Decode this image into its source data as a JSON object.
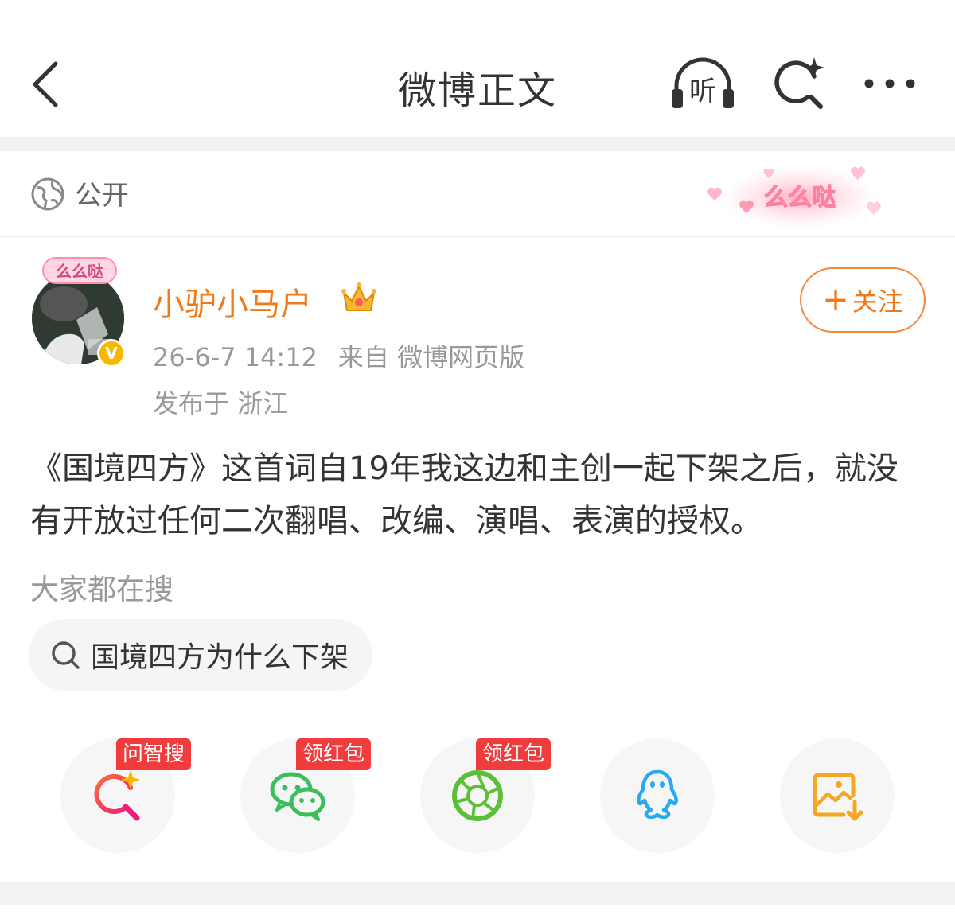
{
  "header": {
    "title": "微博正文",
    "listen_label": "听"
  },
  "visibility": {
    "label": "公开",
    "decoration_text": "么么哒"
  },
  "post": {
    "author": {
      "name": "小驴小马户",
      "avatar_frame_text": "么么哒",
      "verified_mark": "V"
    },
    "timestamp": "26-6-7 14:12",
    "source": "来自 微博网页版",
    "location": "发布于 浙江",
    "follow_button": {
      "plus": "+",
      "label": "关注"
    },
    "text": "《国境四方》这首词自19年我这边和主创一起下架之后，就没有开放过任何二次翻唱、改编、演唱、表演的授权。",
    "search_hint": "大家都在搜",
    "search_chip": "国境四方为什么下架"
  },
  "share": [
    {
      "icon": "ai-search-icon",
      "badge": "问智搜"
    },
    {
      "icon": "wechat-icon",
      "badge": "领红包"
    },
    {
      "icon": "moments-icon",
      "badge": "领红包"
    },
    {
      "icon": "qq-icon"
    },
    {
      "icon": "save-image-icon"
    }
  ],
  "colors": {
    "accent": "#f07a1a",
    "badge": "#f03c3c",
    "wechat": "#3cbf5b",
    "qq": "#2ba8f2",
    "save": "#f5a623"
  }
}
